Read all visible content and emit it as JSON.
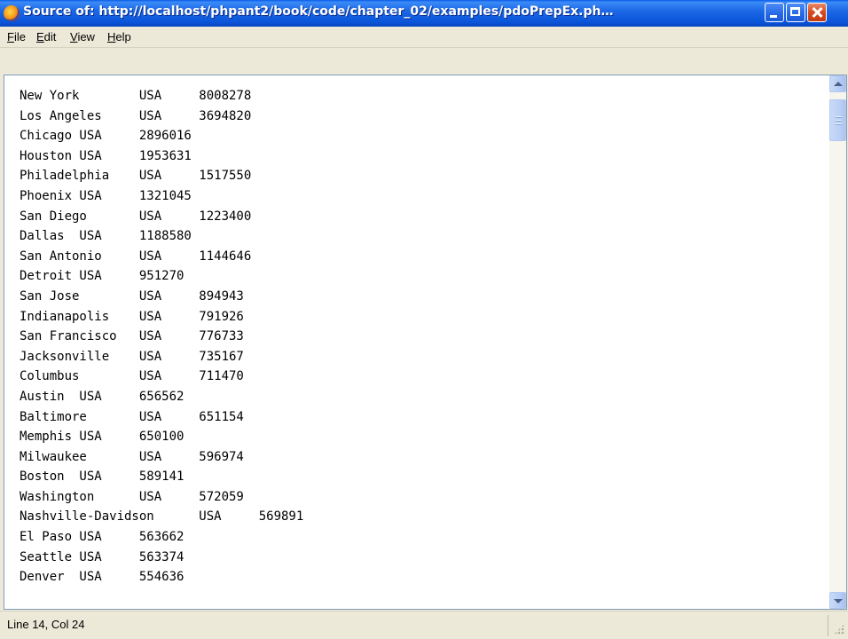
{
  "window": {
    "title": "Source of: http://localhost/phpant2/book/code/chapter_02/examples/pdoPrepEx.ph…",
    "app_icon": "firefox-icon",
    "title_color": "#0a53d8",
    "close_color": "#c23a14"
  },
  "menu": {
    "file": {
      "accel": "F",
      "rest": "ile"
    },
    "edit": {
      "accel": "E",
      "rest": "dit"
    },
    "view": {
      "accel": "V",
      "rest": "iew"
    },
    "help": {
      "accel": "H",
      "rest": "elp"
    }
  },
  "source_lines": [
    "New York        USA     8008278",
    "Los Angeles     USA     3694820",
    "Chicago USA     2896016",
    "Houston USA     1953631",
    "Philadelphia    USA     1517550",
    "Phoenix USA     1321045",
    "San Diego       USA     1223400",
    "Dallas  USA     1188580",
    "San Antonio     USA     1144646",
    "Detroit USA     951270",
    "San Jose        USA     894943",
    "Indianapolis    USA     791926",
    "San Francisco   USA     776733",
    "Jacksonville    USA     735167",
    "Columbus        USA     711470",
    "Austin  USA     656562",
    "Baltimore       USA     651154",
    "Memphis USA     650100",
    "Milwaukee       USA     596974",
    "Boston  USA     589141",
    "Washington      USA     572059",
    "Nashville-Davidson      USA     569891",
    "El Paso USA     563662",
    "Seattle USA     563374",
    "Denver  USA     554636"
  ],
  "statusbar": {
    "position": "Line 14, Col 24"
  }
}
